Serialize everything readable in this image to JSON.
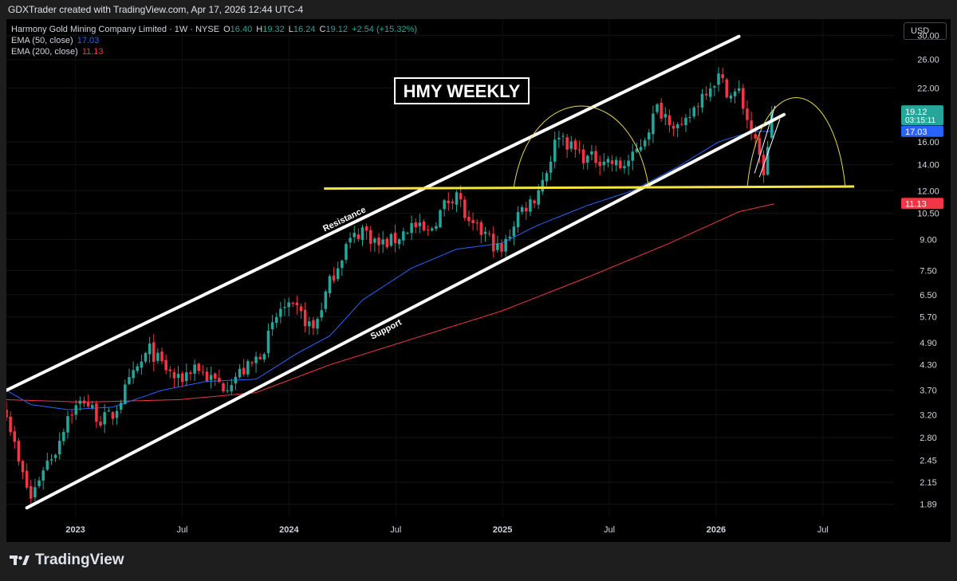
{
  "header": {
    "text": "GDXTrader created with TradingView.com, Apr 17, 2026 12:44 UTC-4"
  },
  "legend": {
    "symbol": "Harmony Gold Mining Company Limited · 1W · NYSE",
    "o_label": "O",
    "o": "16.40",
    "h_label": "H",
    "h": "19.32",
    "l_label": "L",
    "l": "16.24",
    "c_label": "C",
    "c": "19.12",
    "change": "+2.54 (+15.32%)",
    "ema50_label": "EMA (50, close)",
    "ema50": "17.03",
    "ema200_label": "EMA (200, close)",
    "ema200": "11.13"
  },
  "currency_button": "USD",
  "footer": {
    "brand": "TradingView"
  },
  "colors": {
    "up": "#26a69a",
    "down": "#f23645",
    "ema50": "#2962ff",
    "ema200": "#f23645",
    "neckline": "#f5e63c",
    "arcs": "#e8d850",
    "background": "#000000"
  },
  "chart_data": {
    "type": "candlestick",
    "title": "HMY WEEKLY",
    "scale": "log",
    "ylim": [
      1.75,
      33
    ],
    "y_ticks": [
      "30.00",
      "26.00",
      "22.00",
      "19.12",
      "17.03",
      "16.00",
      "14.00",
      "12.00",
      "11.13",
      "10.50",
      "9.00",
      "7.50",
      "6.50",
      "5.70",
      "4.90",
      "4.30",
      "3.70",
      "3.20",
      "2.80",
      "2.45",
      "2.15",
      "1.89"
    ],
    "x_labels": [
      "2023",
      "Jul",
      "2024",
      "Jul",
      "2025",
      "Jul",
      "2026",
      "Jul"
    ],
    "x_range": [
      "2022-09-05",
      "2026-11-01"
    ],
    "last_price_label": {
      "value": "19.12",
      "countdown": "03:15:11"
    },
    "ema50_label": "17.03",
    "ema200_label": "11.13",
    "anchors": [
      [
        "2022-09-05",
        3.3
      ],
      [
        "2022-09-26",
        2.4
      ],
      [
        "2022-10-17",
        1.95
      ],
      [
        "2022-11-07",
        2.35
      ],
      [
        "2022-11-28",
        2.6
      ],
      [
        "2022-12-19",
        3.2
      ],
      [
        "2023-01-16",
        3.5
      ],
      [
        "2023-02-13",
        3.1
      ],
      [
        "2023-03-06",
        3.2
      ],
      [
        "2023-03-27",
        3.7
      ],
      [
        "2023-04-17",
        4.2
      ],
      [
        "2023-05-08",
        4.7
      ],
      [
        "2023-05-29",
        4.3
      ],
      [
        "2023-06-26",
        3.9
      ],
      [
        "2023-07-24",
        4.3
      ],
      [
        "2023-08-14",
        4.0
      ],
      [
        "2023-09-11",
        3.8
      ],
      [
        "2023-10-09",
        4.1
      ],
      [
        "2023-10-30",
        4.3
      ],
      [
        "2023-11-20",
        4.8
      ],
      [
        "2023-12-18",
        6.0
      ],
      [
        "2024-01-15",
        5.9
      ],
      [
        "2024-02-12",
        5.3
      ],
      [
        "2024-03-11",
        7.0
      ],
      [
        "2024-04-08",
        8.7
      ],
      [
        "2024-05-06",
        9.6
      ],
      [
        "2024-06-03",
        8.7
      ],
      [
        "2024-07-01",
        9.0
      ],
      [
        "2024-07-29",
        9.8
      ],
      [
        "2024-08-26",
        9.3
      ],
      [
        "2024-09-23",
        11.0
      ],
      [
        "2024-10-14",
        12.0
      ],
      [
        "2024-11-04",
        9.7
      ],
      [
        "2024-12-02",
        9.3
      ],
      [
        "2024-12-30",
        8.3
      ],
      [
        "2025-01-27",
        10.5
      ],
      [
        "2025-02-24",
        11.5
      ],
      [
        "2025-03-17",
        13.5
      ],
      [
        "2025-04-07",
        17.0
      ],
      [
        "2025-04-28",
        15.5
      ],
      [
        "2025-05-26",
        14.5
      ],
      [
        "2025-06-23",
        14.5
      ],
      [
        "2025-07-21",
        13.8
      ],
      [
        "2025-08-11",
        14.5
      ],
      [
        "2025-09-01",
        16.5
      ],
      [
        "2025-09-22",
        19.5
      ],
      [
        "2025-10-13",
        18.5
      ],
      [
        "2025-11-03",
        17.0
      ],
      [
        "2025-11-24",
        19.5
      ],
      [
        "2025-12-15",
        22.0
      ],
      [
        "2026-01-05",
        23.5
      ],
      [
        "2026-01-26",
        21.0
      ],
      [
        "2026-02-09",
        21.5
      ],
      [
        "2026-03-02",
        17.0
      ],
      [
        "2026-03-23",
        13.5
      ],
      [
        "2026-04-13",
        19.12
      ]
    ],
    "ema50": [
      [
        "2022-09-05",
        3.7
      ],
      [
        "2022-10-17",
        3.4
      ],
      [
        "2022-12-19",
        3.3
      ],
      [
        "2023-03-06",
        3.35
      ],
      [
        "2023-05-29",
        3.7
      ],
      [
        "2023-08-14",
        3.9
      ],
      [
        "2023-11-06",
        3.95
      ],
      [
        "2024-01-15",
        4.6
      ],
      [
        "2024-03-11",
        5.1
      ],
      [
        "2024-05-06",
        6.3
      ],
      [
        "2024-07-29",
        7.6
      ],
      [
        "2024-10-14",
        8.5
      ],
      [
        "2024-12-30",
        8.8
      ],
      [
        "2025-03-03",
        9.8
      ],
      [
        "2025-05-26",
        11.0
      ],
      [
        "2025-08-11",
        12.0
      ],
      [
        "2025-10-27",
        13.8
      ],
      [
        "2026-01-05",
        16.0
      ],
      [
        "2026-03-02",
        17.0
      ],
      [
        "2026-04-13",
        17.03
      ]
    ],
    "ema200": [
      [
        "2022-09-05",
        3.5
      ],
      [
        "2023-01-16",
        3.45
      ],
      [
        "2023-06-26",
        3.5
      ],
      [
        "2023-11-06",
        3.65
      ],
      [
        "2024-03-11",
        4.3
      ],
      [
        "2024-07-29",
        5.0
      ],
      [
        "2024-12-30",
        5.9
      ],
      [
        "2025-05-26",
        7.2
      ],
      [
        "2025-10-13",
        8.8
      ],
      [
        "2026-02-09",
        10.6
      ],
      [
        "2026-04-13",
        11.13
      ]
    ],
    "annotations": {
      "resistance_label": "Resistance",
      "support_label": "Support",
      "resistance_line": [
        [
          "2022-09-05",
          3.7
        ],
        [
          "2026-02-09",
          29.8
        ]
      ],
      "support_line": [
        [
          "2022-10-10",
          1.85
        ],
        [
          "2026-04-27",
          18.8
        ]
      ],
      "neckline": [
        [
          "2024-03-01",
          12.15
        ],
        [
          "2026-08-25",
          12.3
        ]
      ],
      "neckline_level": 12.2
    }
  }
}
